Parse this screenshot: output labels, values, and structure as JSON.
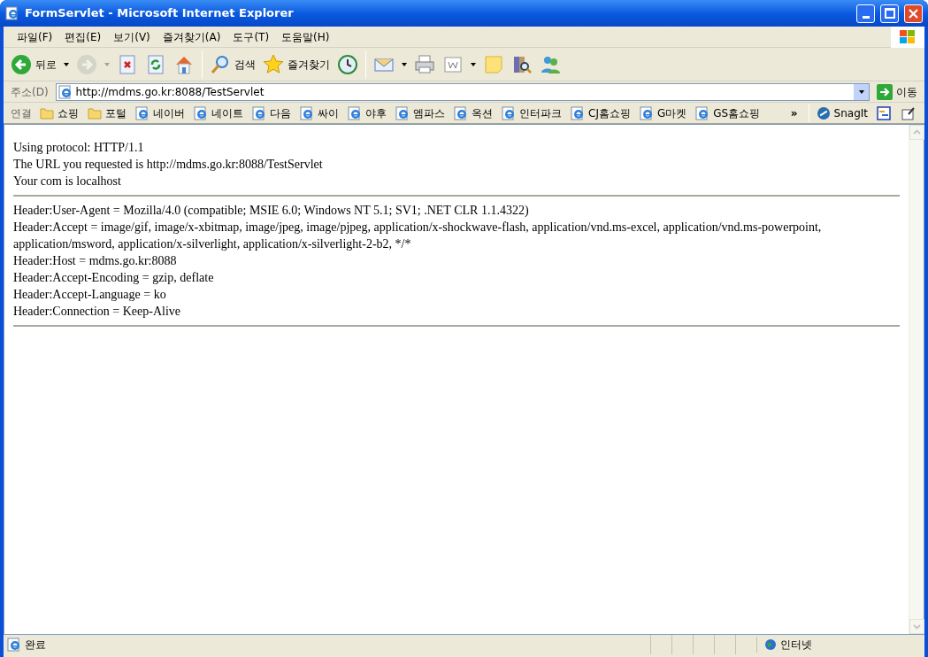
{
  "window": {
    "title": "FormServlet - Microsoft Internet Explorer"
  },
  "menu": [
    "파일(F)",
    "편집(E)",
    "보기(V)",
    "즐겨찾기(A)",
    "도구(T)",
    "도움말(H)"
  ],
  "toolbar": [
    {
      "kind": "back",
      "label": "뒤로",
      "disabled": false
    },
    {
      "kind": "forward",
      "disabled": true
    },
    {
      "kind": "stop",
      "disabled": false
    },
    {
      "kind": "refresh",
      "disabled": false
    },
    {
      "kind": "home",
      "disabled": false
    },
    {
      "kind": "search",
      "label": "검색",
      "disabled": false
    },
    {
      "kind": "favorites",
      "label": "즐겨찾기",
      "disabled": false
    },
    {
      "kind": "history",
      "disabled": false
    },
    {
      "kind": "mail",
      "disabled": false
    },
    {
      "kind": "print",
      "disabled": false
    },
    {
      "kind": "edit",
      "disabled": false
    },
    {
      "kind": "note",
      "disabled": false
    },
    {
      "kind": "research",
      "disabled": false
    },
    {
      "kind": "messenger",
      "disabled": false
    }
  ],
  "address": {
    "label": "주소(D)",
    "url": "http://mdms.go.kr:8088/TestServlet",
    "go": "이동"
  },
  "links": {
    "label": "연결",
    "items": [
      {
        "kind": "folder",
        "label": "쇼핑"
      },
      {
        "kind": "folder",
        "label": "포털"
      },
      {
        "kind": "page",
        "label": "네이버"
      },
      {
        "kind": "page",
        "label": "네이트"
      },
      {
        "kind": "page",
        "label": "다음"
      },
      {
        "kind": "page",
        "label": "싸이"
      },
      {
        "kind": "page",
        "label": "야후"
      },
      {
        "kind": "page",
        "label": "엠파스"
      },
      {
        "kind": "page",
        "label": "옥션"
      },
      {
        "kind": "page",
        "label": "인터파크"
      },
      {
        "kind": "page",
        "label": "CJ홈쇼핑"
      },
      {
        "kind": "page",
        "label": "G마켓"
      },
      {
        "kind": "page",
        "label": "GS홈쇼핑"
      }
    ],
    "more": "»",
    "snagit": "SnagIt"
  },
  "content": {
    "sections": [
      [
        "Using protocol: HTTP/1.1",
        "The URL you requested is http://mdms.go.kr:8088/TestServlet",
        "Your com is localhost"
      ],
      [
        "Header:User-Agent = Mozilla/4.0 (compatible; MSIE 6.0; Windows NT 5.1; SV1; .NET CLR 1.1.4322)",
        "Header:Accept = image/gif, image/x-xbitmap, image/jpeg, image/pjpeg, application/x-shockwave-flash, application/vnd.ms-excel, application/vnd.ms-powerpoint, application/msword, application/x-silverlight, application/x-silverlight-2-b2, */*",
        "Header:Host = mdms.go.kr:8088",
        "Header:Accept-Encoding = gzip, deflate",
        "Header:Accept-Language = ko",
        "Header:Connection = Keep-Alive"
      ]
    ]
  },
  "status_bar": {
    "text": "완료",
    "zone": "인터넷"
  }
}
